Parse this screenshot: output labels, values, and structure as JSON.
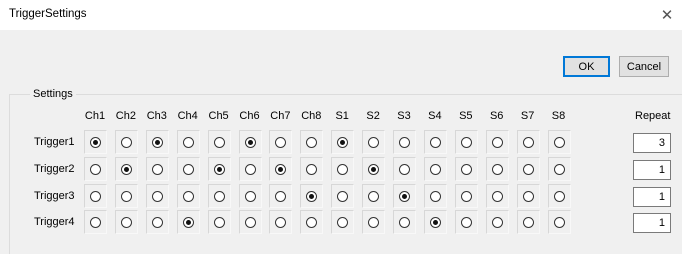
{
  "window": {
    "title": "TriggerSettings",
    "close_glyph": "✕"
  },
  "buttons": {
    "ok": "OK",
    "cancel": "Cancel"
  },
  "settings": {
    "group_label": "Settings",
    "columns": [
      "Ch1",
      "Ch2",
      "Ch3",
      "Ch4",
      "Ch5",
      "Ch6",
      "Ch7",
      "Ch8",
      "S1",
      "S2",
      "S3",
      "S4",
      "S5",
      "S6",
      "S7",
      "S8"
    ],
    "repeat_label": "Repeat",
    "rows": [
      {
        "label": "Trigger1",
        "selected": [
          true,
          false,
          true,
          false,
          false,
          true,
          false,
          false,
          true,
          false,
          false,
          false,
          false,
          false,
          false,
          false
        ],
        "repeat": "3"
      },
      {
        "label": "Trigger2",
        "selected": [
          false,
          true,
          false,
          false,
          true,
          false,
          true,
          false,
          false,
          true,
          false,
          false,
          false,
          false,
          false,
          false
        ],
        "repeat": "1"
      },
      {
        "label": "Trigger3",
        "selected": [
          false,
          false,
          false,
          false,
          false,
          false,
          false,
          true,
          false,
          false,
          true,
          false,
          false,
          false,
          false,
          false
        ],
        "repeat": "1"
      },
      {
        "label": "Trigger4",
        "selected": [
          false,
          false,
          false,
          true,
          false,
          false,
          false,
          false,
          false,
          false,
          false,
          true,
          false,
          false,
          false,
          false
        ],
        "repeat": "1"
      }
    ]
  }
}
